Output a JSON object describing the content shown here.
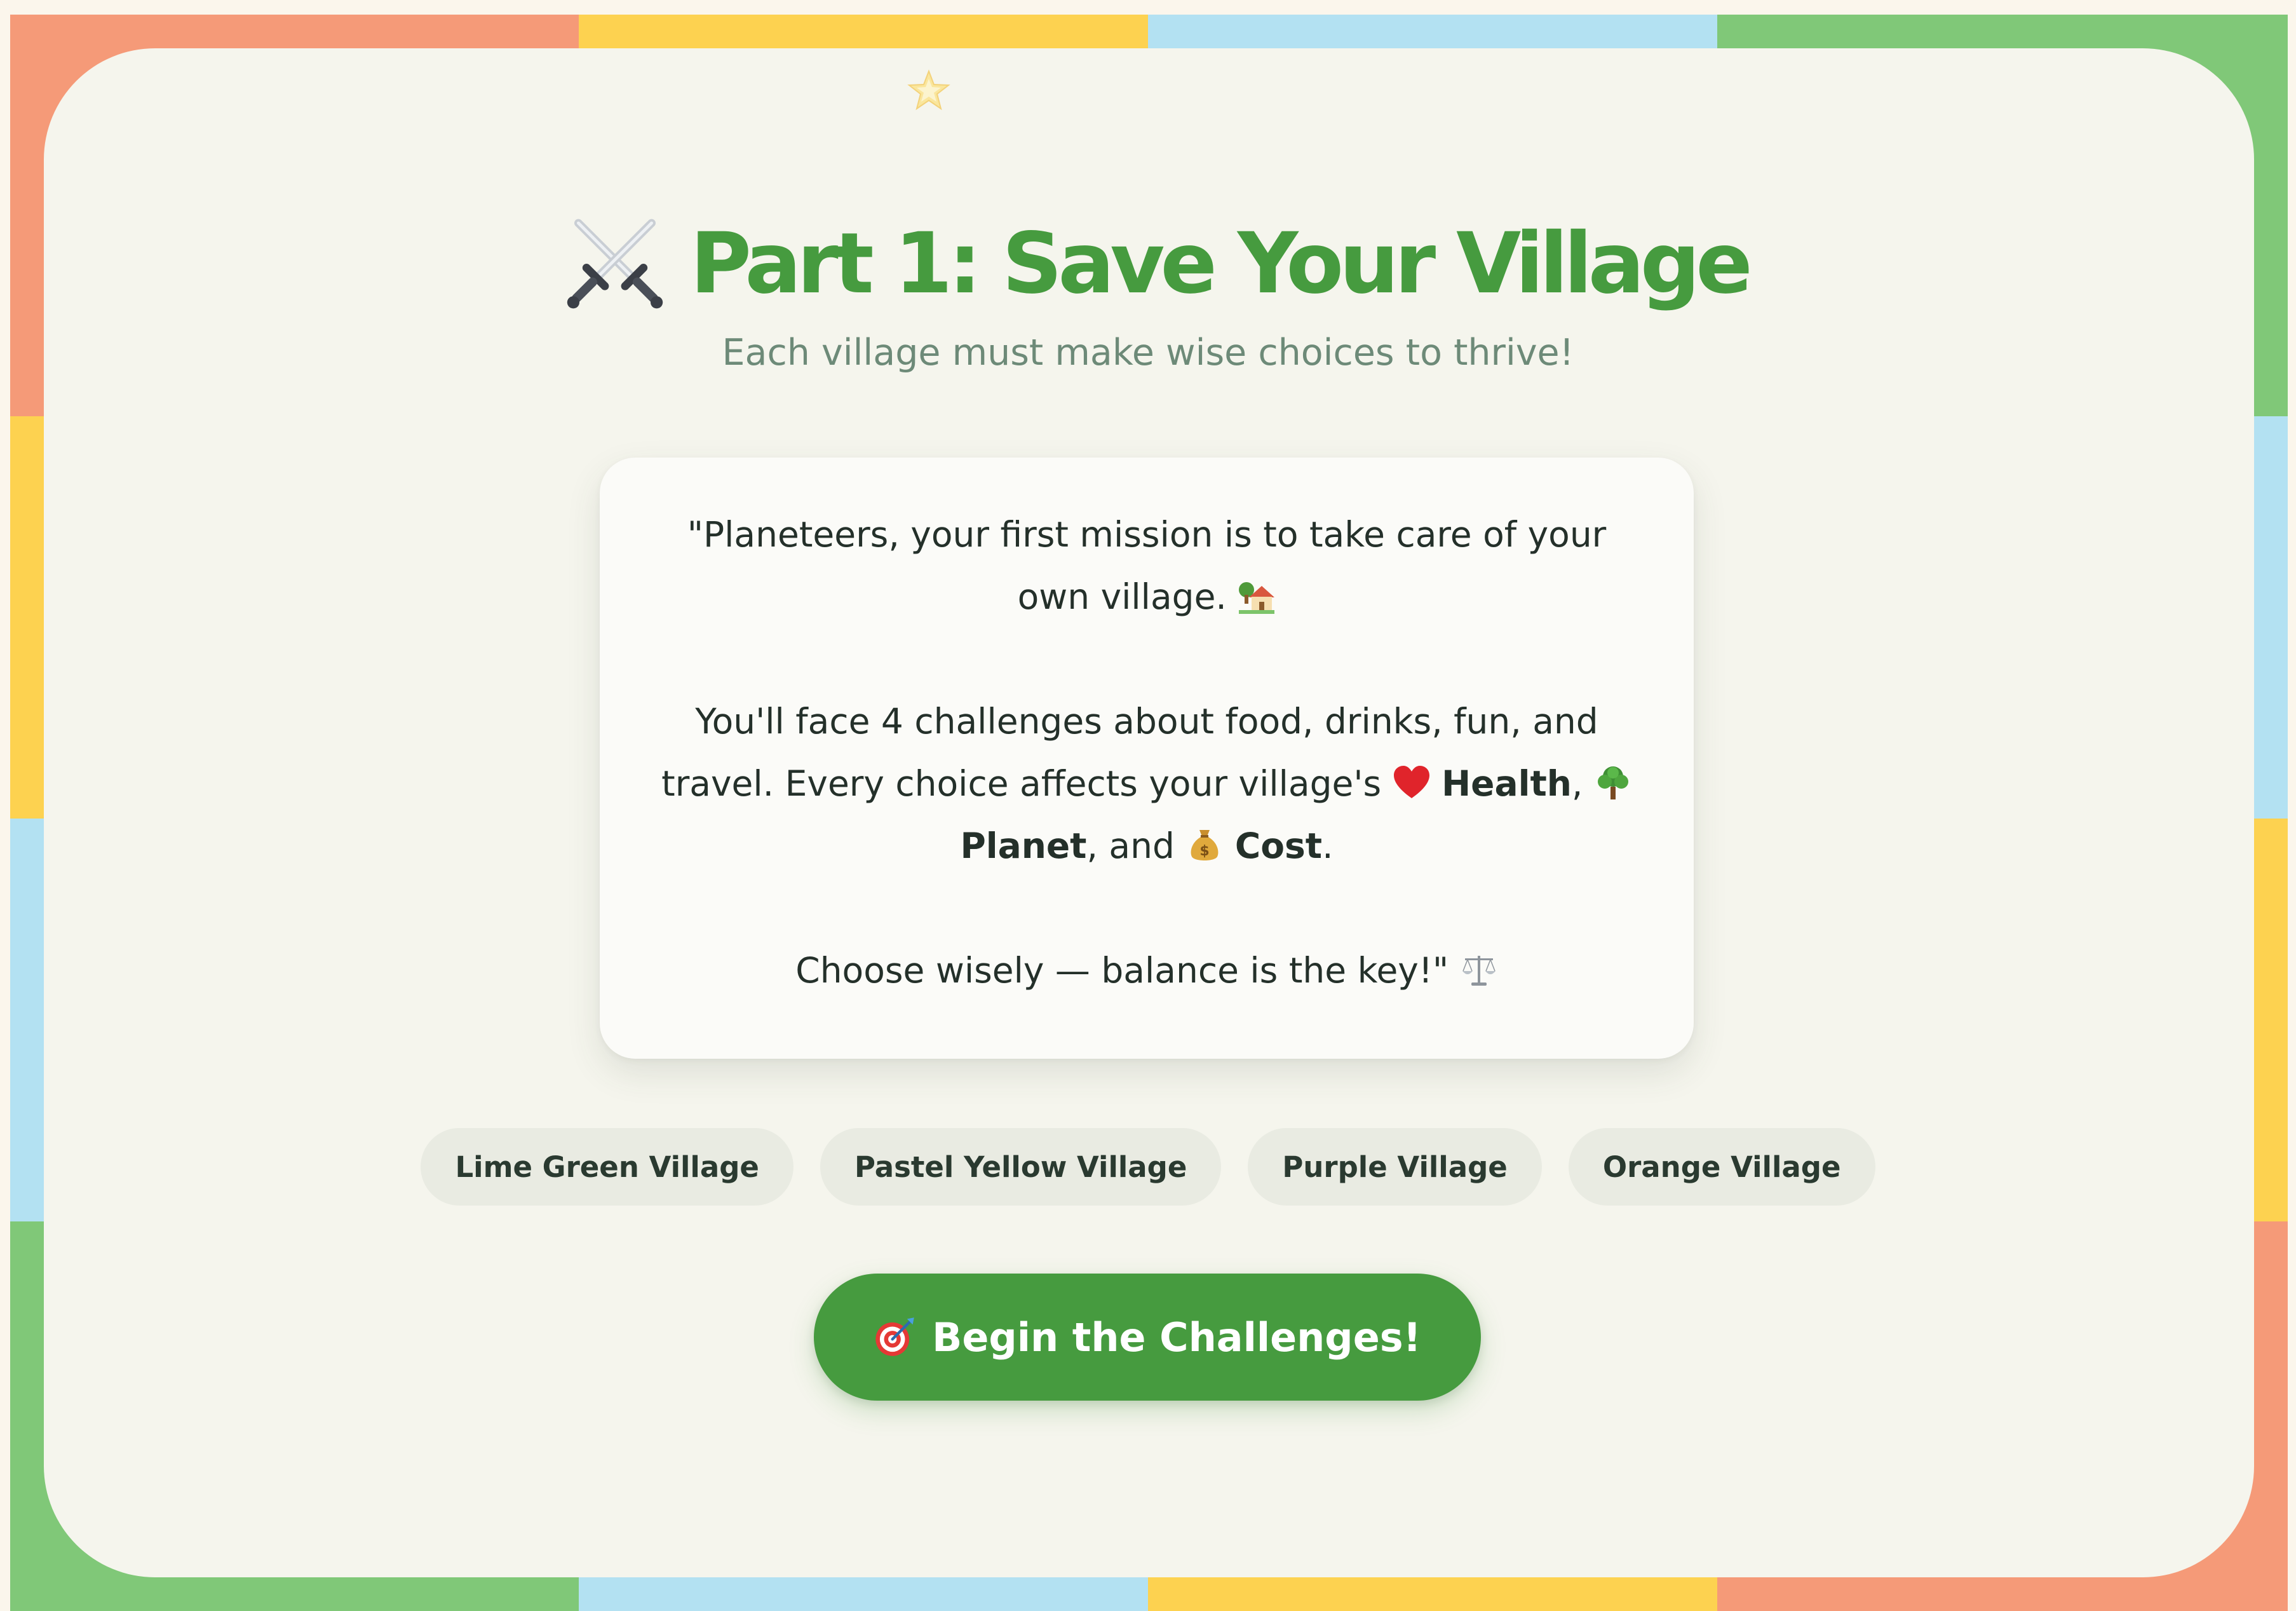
{
  "colors": {
    "page_background": "#fbf6ec",
    "card_background": "#f5f5ed",
    "accent_green": "#469b3f",
    "subtitle_gray": "#6d8a78",
    "chip_background": "#e9ebe2",
    "frame_palette": [
      "#f59a78",
      "#fdd250",
      "#b3e1f2",
      "#80c878"
    ]
  },
  "decor": {
    "sparkle_icon": "sparkle-star-icon"
  },
  "header": {
    "icon": "crossed-swords-icon",
    "title": "Part 1: Save Your Village",
    "subtitle": "Each village must make wise choices to thrive!"
  },
  "mission": {
    "intro": "\"Planeteers, your first mission is to take care of your own village.",
    "intro_icon": "house-with-garden-icon",
    "challenges_text": "You'll face 4 challenges about food, drinks, fun, and travel. Every choice affects your village's",
    "health_icon": "red-heart-icon",
    "health_label": "Health",
    "planet_icon": "tree-icon",
    "planet_label": "Planet",
    "and_text": ", and",
    "cost_icon": "money-bag-icon",
    "cost_label": "Cost",
    "closing": "Choose wisely — balance is the key!\"",
    "closing_icon": "balance-scale-icon"
  },
  "villages": [
    {
      "label": "Lime Green Village"
    },
    {
      "label": "Pastel Yellow Village"
    },
    {
      "label": "Purple Village"
    },
    {
      "label": "Orange Village"
    }
  ],
  "cta": {
    "icon": "target-dart-icon",
    "label": "Begin the Challenges!"
  }
}
